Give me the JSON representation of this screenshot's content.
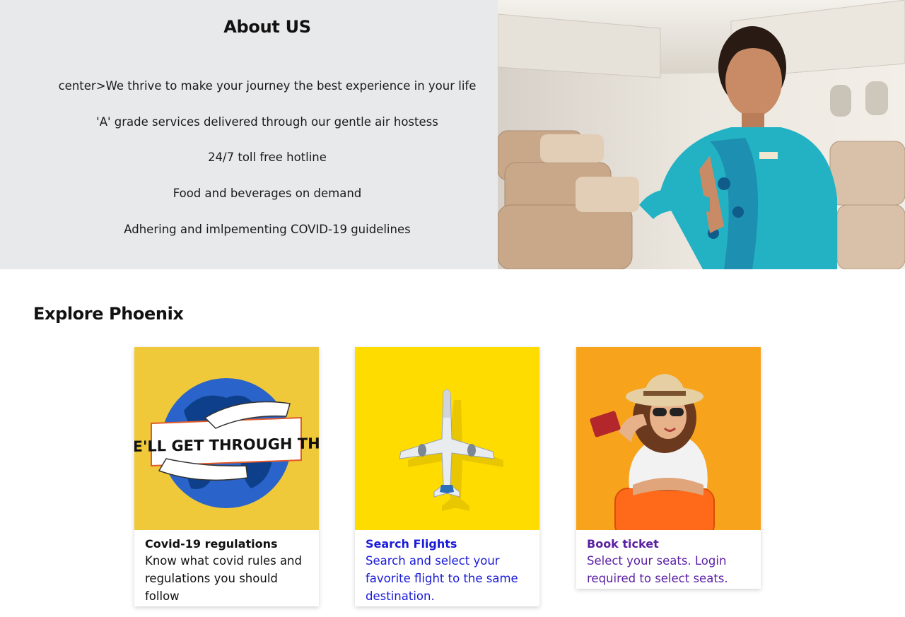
{
  "about": {
    "title": "About US",
    "lines": [
      "center>We thrive to make your journey the best experience in your life",
      "'A' grade services delivered through our gentle air hostess",
      "24/7 toll free hotline",
      "Food and beverages on demand",
      "Adhering and imlpementing COVID-19 guidelines"
    ]
  },
  "explore": {
    "title": "Explore Phoenix",
    "cards": [
      {
        "title": "Covid-19 regulations",
        "description": "Know what covid rules and regulations you should follow",
        "image_text": "WE'LL GET THROUGH THIS",
        "accent": "#f0c93a"
      },
      {
        "title": "Search Flights",
        "description": "Search and select your favorite flight to the same destination.",
        "accent": "#ffdc00"
      },
      {
        "title": "Book ticket",
        "description": "Select your seats. Login required to select seats.",
        "accent": "#f7a41c"
      }
    ]
  },
  "colors": {
    "about_bg": "#e8e9eb",
    "search_text": "#1a1ad8",
    "book_text": "#5a1fa3"
  }
}
